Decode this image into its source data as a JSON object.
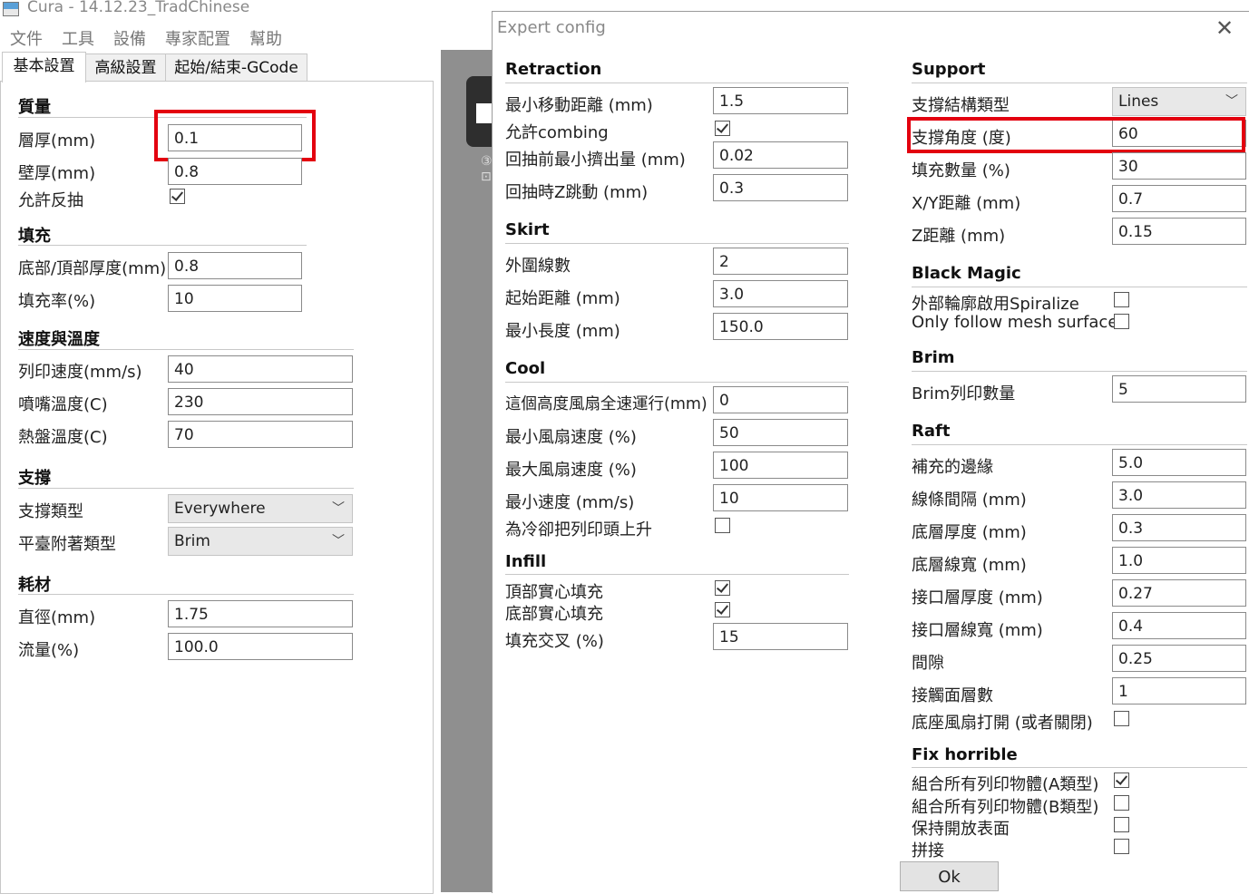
{
  "window": {
    "title": "Cura - 14.12.23_TradChinese",
    "menu": [
      "文件",
      "工具",
      "設備",
      "專家配置",
      "幫助"
    ],
    "tabs": [
      "基本設置",
      "高級設置",
      "起始/結束-GCode"
    ]
  },
  "basic": {
    "quality": {
      "title": "質量",
      "layer_height_label": "層厚(mm)",
      "layer_height": "0.1",
      "shell_label": "壁厚(mm)",
      "shell": "0.8",
      "retraction_label": "允許反抽",
      "retraction_checked": true
    },
    "fill": {
      "title": "填充",
      "bottom_top_label": "底部/頂部厚度(mm)",
      "bottom_top": "0.8",
      "density_label": "填充率(%)",
      "density": "10"
    },
    "speed": {
      "title": "速度與溫度",
      "print_speed_label": "列印速度(mm/s)",
      "print_speed": "40",
      "nozzle_temp_label": "噴嘴溫度(C)",
      "nozzle_temp": "230",
      "bed_temp_label": "熱盤溫度(C)",
      "bed_temp": "70"
    },
    "support": {
      "title": "支撐",
      "type_label": "支撐類型",
      "type": "Everywhere",
      "adhesion_label": "平臺附著類型",
      "adhesion": "Brim"
    },
    "filament": {
      "title": "耗材",
      "diameter_label": "直徑(mm)",
      "diameter": "1.75",
      "flow_label": "流量(%)",
      "flow": "100.0"
    }
  },
  "expert": {
    "title": "Expert config",
    "close_glyph": "✕",
    "ok_label": "Ok",
    "retraction": {
      "title": "Retraction",
      "min_travel_label": "最小移動距離 (mm)",
      "min_travel": "1.5",
      "combing_label": "允許combing",
      "combing_checked": true,
      "min_extrusion_label": "回抽前最小擠出量 (mm)",
      "min_extrusion": "0.02",
      "z_hop_label": "回抽時Z跳動 (mm)",
      "z_hop": "0.3"
    },
    "skirt": {
      "title": "Skirt",
      "line_count_label": "外圍線數",
      "line_count": "2",
      "start_distance_label": "起始距離 (mm)",
      "start_distance": "3.0",
      "min_length_label": "最小長度 (mm)",
      "min_length": "150.0"
    },
    "cool": {
      "title": "Cool",
      "fan_full_height_label": "這個高度風扇全速運行(mm)",
      "fan_full_height": "0",
      "fan_min_label": "最小風扇速度 (%)",
      "fan_min": "50",
      "fan_max_label": "最大風扇速度 (%)",
      "fan_max": "100",
      "min_speed_label": "最小速度 (mm/s)",
      "min_speed": "10",
      "head_lift_label": "為冷卻把列印頭上升",
      "head_lift_checked": false
    },
    "infill": {
      "title": "Infill",
      "solid_top_label": "頂部實心填充",
      "solid_top_checked": true,
      "solid_bottom_label": "底部實心填充",
      "solid_bottom_checked": true,
      "overlap_label": "填充交叉 (%)",
      "overlap": "15"
    },
    "support": {
      "title": "Support",
      "structure_label": "支撐結構類型",
      "structure": "Lines",
      "angle_label": "支撐角度 (度)",
      "angle": "60",
      "fill_label": "填充數量 (%)",
      "fill": "30",
      "xy_label": "X/Y距離 (mm)",
      "xy": "0.7",
      "z_label": "Z距離 (mm)",
      "z": "0.15"
    },
    "black_magic": {
      "title": "Black Magic",
      "spiralize_label": "外部輪廓啟用Spiralize",
      "spiralize_checked": false,
      "mesh_surface_label": "Only follow mesh surface",
      "mesh_surface_checked": false
    },
    "brim": {
      "title": "Brim",
      "line_count_label": "Brim列印數量",
      "line_count": "5"
    },
    "raft": {
      "title": "Raft",
      "margin_label": "補充的邊緣",
      "margin": "5.0",
      "line_spacing_label": "線條間隔 (mm)",
      "line_spacing": "3.0",
      "base_thickness_label": "底層厚度 (mm)",
      "base_thickness": "0.3",
      "base_width_label": "底層線寬 (mm)",
      "base_width": "1.0",
      "interface_thickness_label": "接口層厚度 (mm)",
      "interface_thickness": "0.27",
      "interface_width_label": "接口層線寬 (mm)",
      "interface_width": "0.4",
      "air_gap_label": "間隙",
      "air_gap": "0.25",
      "surface_layers_label": "接觸面層數",
      "surface_layers": "1",
      "fan_label": "底座風扇打開 (或者關閉)",
      "fan_checked": false
    },
    "fix_horrible": {
      "title": "Fix horrible",
      "union_a_label": "組合所有列印物體(A類型)",
      "union_a_checked": true,
      "union_b_label": "組合所有列印物體(B類型)",
      "union_b_checked": false,
      "keep_open_label": "保持開放表面",
      "keep_open_checked": false,
      "stitch_label": "拼接",
      "stitch_checked": false
    }
  },
  "highlight_color": "#e3000f"
}
